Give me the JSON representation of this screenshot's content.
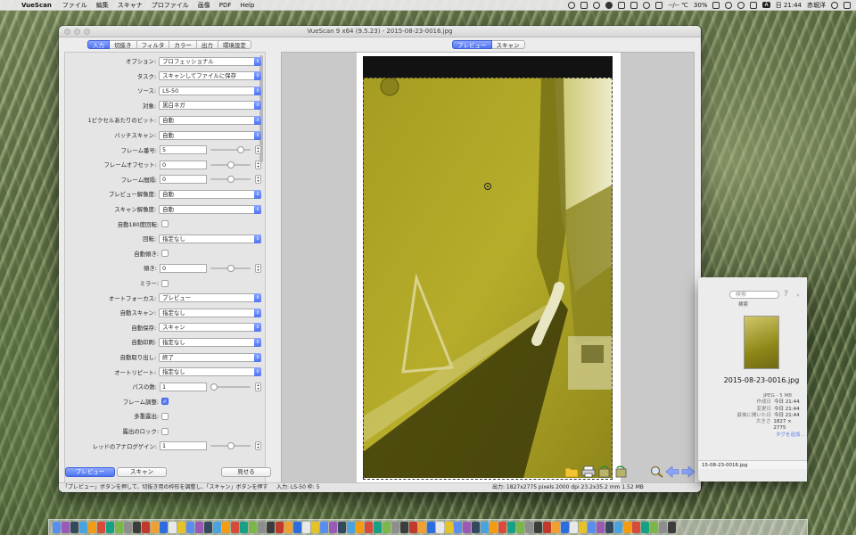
{
  "menubar": {
    "apple": "",
    "app": "VueScan",
    "items": [
      "ファイル",
      "編集",
      "スキャナ",
      "プロファイル",
      "画像",
      "PDF",
      "Help"
    ],
    "status_temp": "--/-- ℃",
    "battery": "30%",
    "input_source": "A",
    "clock": "日 21:44",
    "user": "赤堀洋"
  },
  "window": {
    "title": "VueScan 9 x64 (9.5.23) - 2015-08-23-0016.jpg",
    "left_tabs": [
      "入力",
      "切抜き",
      "フィルタ",
      "カラー",
      "出力",
      "環境設定"
    ],
    "right_tabs": [
      "プレビュー",
      "スキャン"
    ]
  },
  "options": [
    {
      "label": "オプション:",
      "type": "select",
      "value": "プロフェッショナル"
    },
    {
      "label": "タスク:",
      "type": "select",
      "value": "スキャンしてファイルに保存"
    },
    {
      "label": "ソース:",
      "type": "select",
      "value": "LS-50"
    },
    {
      "label": "対象:",
      "type": "select",
      "value": "黒白ネガ"
    },
    {
      "label": "1ピクセルあたりのビット:",
      "type": "select",
      "value": "自動"
    },
    {
      "label": "バッチスキャン:",
      "type": "select",
      "value": "自動"
    },
    {
      "label": "フレーム番号:",
      "type": "number",
      "value": "5",
      "slider": 0.8
    },
    {
      "label": "フレームオフセット:",
      "type": "number",
      "value": "0",
      "slider": 0.5
    },
    {
      "label": "フレーム間隔:",
      "type": "number",
      "value": "0",
      "slider": 0.5
    },
    {
      "label": "プレビュー解像度:",
      "type": "select",
      "value": "自動"
    },
    {
      "label": "スキャン解像度:",
      "type": "select",
      "value": "自動"
    },
    {
      "label": "自動180度回転:",
      "type": "check",
      "checked": false
    },
    {
      "label": "回転:",
      "type": "select",
      "value": "指定なし"
    },
    {
      "label": "自動傾き:",
      "type": "check",
      "checked": false
    },
    {
      "label": "傾き:",
      "type": "number",
      "value": "0",
      "slider": 0.5
    },
    {
      "label": "ミラー:",
      "type": "check",
      "checked": false
    },
    {
      "label": "オートフォーカス:",
      "type": "select",
      "value": "プレビュー"
    },
    {
      "label": "自動スキャン:",
      "type": "select",
      "value": "指定なし"
    },
    {
      "label": "自動保存:",
      "type": "select",
      "value": "スキャン"
    },
    {
      "label": "自動印刷:",
      "type": "select",
      "value": "指定なし"
    },
    {
      "label": "自動取り出し:",
      "type": "select",
      "value": "終了"
    },
    {
      "label": "オートリピート:",
      "type": "select",
      "value": "指定なし"
    },
    {
      "label": "パスの数:",
      "type": "number",
      "value": "1",
      "slider": 0.0
    },
    {
      "label": "フレーム調整:",
      "type": "check",
      "checked": true
    },
    {
      "label": "多重露出:",
      "type": "check",
      "checked": false
    },
    {
      "label": "露出のロック:",
      "type": "check",
      "checked": false
    },
    {
      "label": "レッドのアナログゲイン:",
      "type": "number",
      "value": "1",
      "slider": 0.5
    }
  ],
  "buttons": {
    "preview": "プレビュー",
    "scan": "スキャン",
    "show": "見せる"
  },
  "status": {
    "left": "「プレビュー」ボタンを押して、切抜き用の枠形を調整し、「スキャン」ボタンを押す",
    "middle": "入力: LS-50 枠: 5",
    "right": "出力: 1827x2775 pixels 2000 dpi 23.2x35.2 mm 1.52 MB"
  },
  "finder": {
    "search_placeholder": "検索",
    "search_label": "検索",
    "filename": "2015-08-23-0016.jpg",
    "type": "JPEG - 5 MB",
    "meta": [
      {
        "key": "作成日",
        "value": "今日 21:44"
      },
      {
        "key": "変更日",
        "value": "今日 21:44"
      },
      {
        "key": "最後に開いた日",
        "value": "今日 21:44"
      },
      {
        "key": "大きさ",
        "value": "1827 × 2775"
      }
    ],
    "add_tags": "タグを追加...",
    "bottom_file": "15-08-23-0016.jpg"
  },
  "colors": {
    "accent": "#4f74f2",
    "photo_tint": "#b8ae29"
  }
}
